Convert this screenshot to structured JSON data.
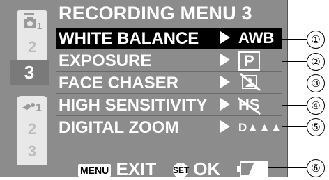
{
  "menu_title": "RECORDING MENU 3",
  "tabs_top": [
    "1",
    "2",
    "3"
  ],
  "tabs_bottom": [
    "1",
    "2",
    "3"
  ],
  "items": [
    {
      "label": "WHITE BALANCE",
      "value": "AWB",
      "callout": "①"
    },
    {
      "label": "EXPOSURE",
      "value": "P",
      "callout": "②"
    },
    {
      "label": "FACE CHASER",
      "value": "face-chaser-off-icon",
      "callout": "③"
    },
    {
      "label": "HIGH SENSITIVITY",
      "value": "HS",
      "callout": "④"
    },
    {
      "label": "DIGITAL ZOOM",
      "value": "D▲▲▲",
      "callout": "⑤"
    }
  ],
  "footer": {
    "menu_button": "MENU",
    "exit_label": "EXIT",
    "set_button": "SET",
    "ok_label": "OK",
    "battery_callout": "⑥"
  },
  "selected_index": 0
}
